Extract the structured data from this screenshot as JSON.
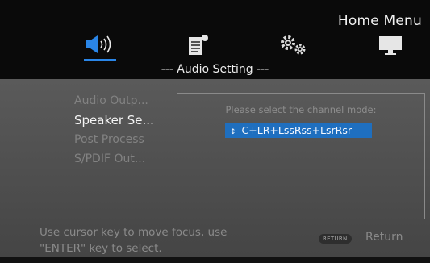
{
  "header": {
    "title": "Home Menu",
    "tabs": [
      {
        "icon": "speaker-icon",
        "active": true
      },
      {
        "icon": "info-document-icon",
        "active": false
      },
      {
        "icon": "gears-icon",
        "active": false
      },
      {
        "icon": "monitor-icon",
        "active": false
      }
    ],
    "section_title": "--- Audio Setting ---"
  },
  "menu": {
    "items": [
      {
        "label": "Audio Outp...",
        "active": false
      },
      {
        "label": "Speaker Se...",
        "active": true
      },
      {
        "label": "Post Process",
        "active": false
      },
      {
        "label": "S/PDIF Out...",
        "active": false
      }
    ]
  },
  "dialog": {
    "prompt": "Please select the channel mode:",
    "selected_value": "C+LR+LssRss+LsrRsr",
    "updown_icon": "updown-arrow-icon"
  },
  "footer": {
    "hint_line1": "Use cursor key to move focus, use",
    "hint_line2": "\"ENTER\" key to select.",
    "return_badge": "RETURN",
    "return_label": "Return"
  },
  "colors": {
    "accent": "#2a86e8",
    "selection": "#1f6fbf",
    "panel": "#555555"
  }
}
